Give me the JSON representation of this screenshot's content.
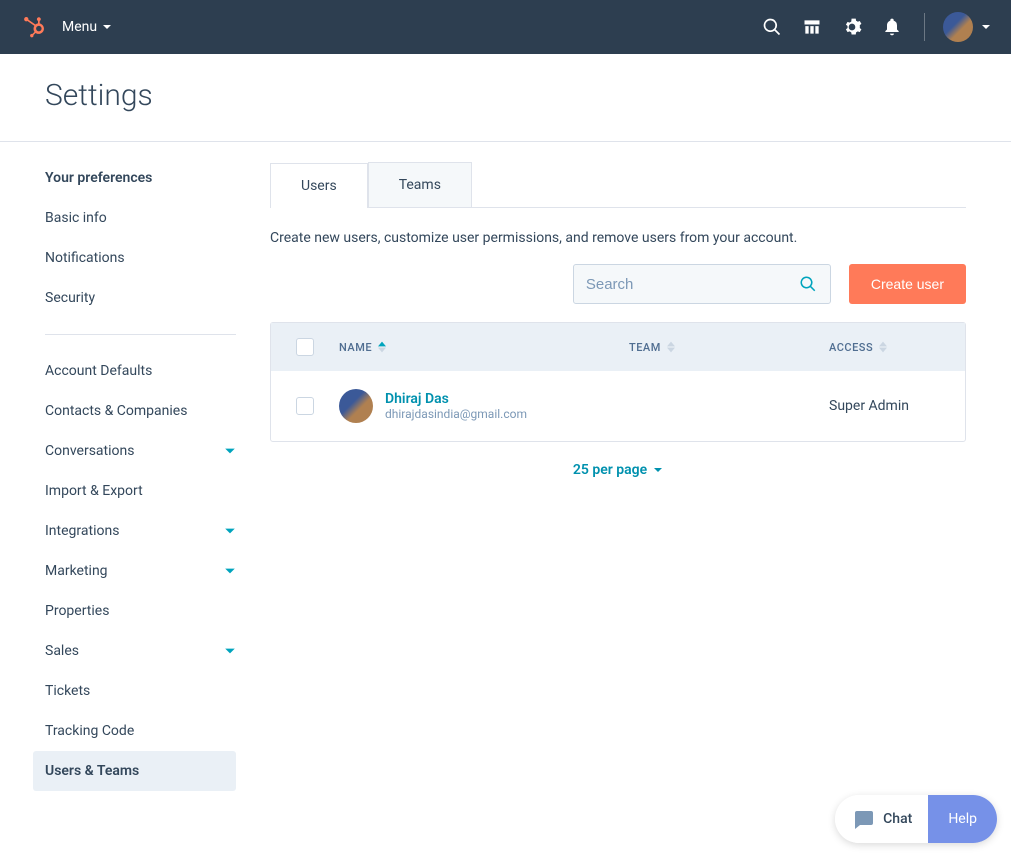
{
  "topnav": {
    "menu_label": "Menu"
  },
  "page": {
    "title": "Settings"
  },
  "sidebar": {
    "heading": "Your preferences",
    "group1": [
      {
        "label": "Basic info"
      },
      {
        "label": "Notifications"
      },
      {
        "label": "Security"
      }
    ],
    "group2": [
      {
        "label": "Account Defaults",
        "expandable": false
      },
      {
        "label": "Contacts & Companies",
        "expandable": false
      },
      {
        "label": "Conversations",
        "expandable": true
      },
      {
        "label": "Import & Export",
        "expandable": false
      },
      {
        "label": "Integrations",
        "expandable": true
      },
      {
        "label": "Marketing",
        "expandable": true
      },
      {
        "label": "Properties",
        "expandable": false
      },
      {
        "label": "Sales",
        "expandable": true
      },
      {
        "label": "Tickets",
        "expandable": false
      },
      {
        "label": "Tracking Code",
        "expandable": false
      },
      {
        "label": "Users & Teams",
        "expandable": false,
        "active": true
      }
    ]
  },
  "tabs": [
    {
      "label": "Users",
      "active": true
    },
    {
      "label": "Teams",
      "active": false
    }
  ],
  "main": {
    "description": "Create new users, customize user permissions, and remove users from your account.",
    "search_placeholder": "Search",
    "create_button": "Create user"
  },
  "table": {
    "headers": {
      "name": "NAME",
      "team": "TEAM",
      "access": "ACCESS"
    },
    "rows": [
      {
        "name": "Dhiraj Das",
        "email": "dhirajdasindia@gmail.com",
        "team": "",
        "access": "Super Admin"
      }
    ]
  },
  "pagination": {
    "label": "25 per page"
  },
  "chat": {
    "chat_label": "Chat",
    "help_label": "Help"
  }
}
